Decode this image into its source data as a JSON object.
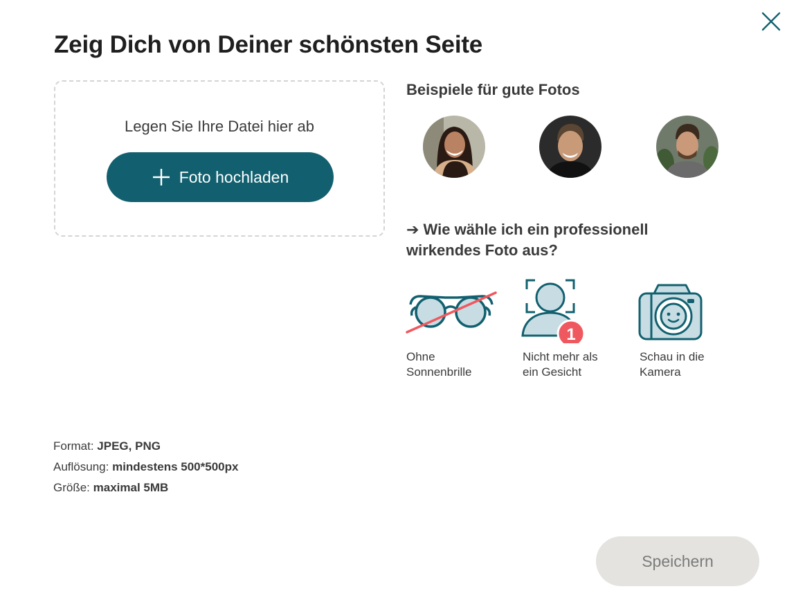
{
  "dialog": {
    "title": "Zeig Dich von Deiner schönsten Seite"
  },
  "close_icon": "close-icon",
  "upload": {
    "drop_text": "Legen Sie Ihre Datei hier ab",
    "button_label": "Foto hochladen",
    "button_color": "#12606f"
  },
  "examples": {
    "title": "Beispiele für gute Fotos",
    "avatars": [
      "example-photo-woman",
      "example-photo-man-smiling",
      "example-photo-man-beard"
    ]
  },
  "guide": {
    "title": "➔ Wie wähle ich ein professionell wirkendes Foto aus?",
    "tips": [
      {
        "icon": "crossed-sunglasses-icon",
        "label_line1": "Ohne",
        "label_line2": "Sonnenbrille"
      },
      {
        "icon": "single-face-icon",
        "badge": "1",
        "label_line1": "Nicht mehr als",
        "label_line2": "ein Gesicht"
      },
      {
        "icon": "camera-face-icon",
        "label_line1": "Schau in die",
        "label_line2": "Kamera"
      }
    ]
  },
  "requirements": {
    "format_label": "Format:",
    "format_value": "JPEG, PNG",
    "resolution_label": "Auflösung:",
    "resolution_value": "mindestens 500*500px",
    "size_label": "Größe:",
    "size_value": "maximal 5MB"
  },
  "footer": {
    "save_label": "Speichern",
    "save_state": "disabled"
  },
  "colors": {
    "primary": "#12606f",
    "accent_red": "#f0585f",
    "icon_fill": "#c7dde3",
    "disabled_bg": "#e4e3df"
  }
}
